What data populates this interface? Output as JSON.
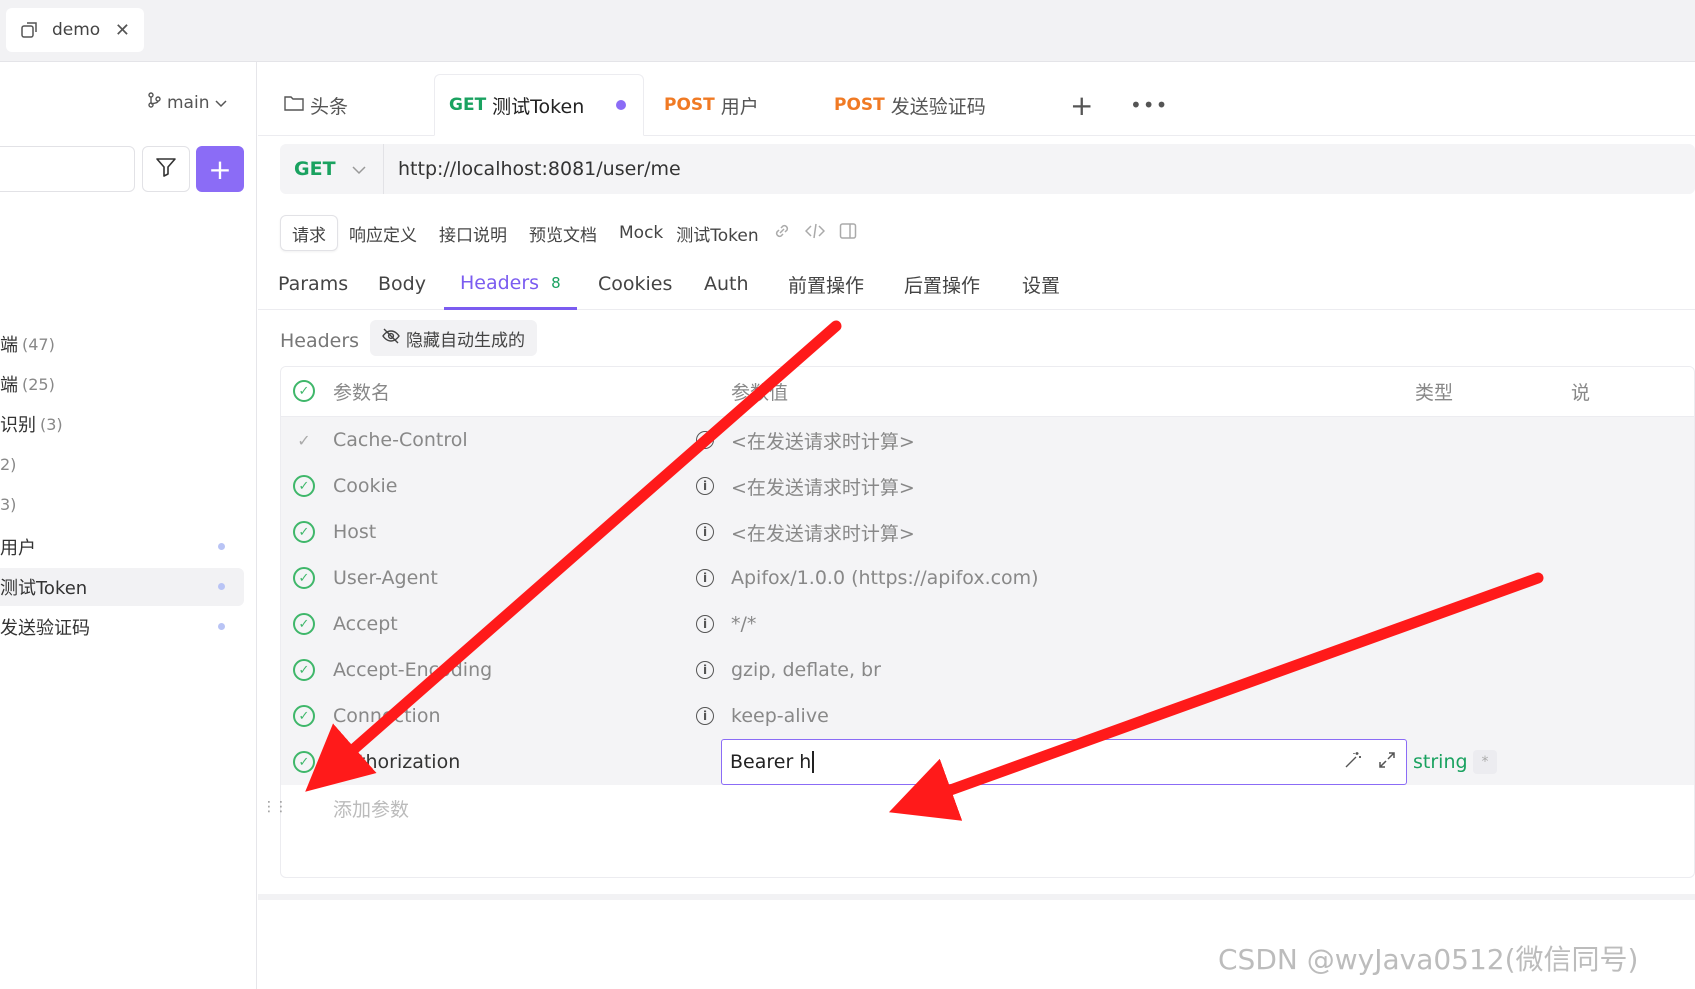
{
  "window_tab": {
    "title": "demo",
    "close": "✕"
  },
  "sidebar": {
    "branch": "main",
    "items": [
      {
        "label": "端",
        "count": "(47)"
      },
      {
        "label": "端",
        "count": "(25)"
      },
      {
        "label": "识别",
        "count": "(3)"
      },
      {
        "label": "2)",
        "count": ""
      },
      {
        "label": "3)",
        "count": ""
      },
      {
        "label": "用户",
        "count": ""
      },
      {
        "label": "测试Token",
        "count": ""
      },
      {
        "label": "发送验证码",
        "count": ""
      }
    ]
  },
  "request_tabs": [
    {
      "method": "",
      "label": "头条"
    },
    {
      "method": "GET",
      "label": "测试Token"
    },
    {
      "method": "POST",
      "label": "用户"
    },
    {
      "method": "POST",
      "label": "发送验证码"
    }
  ],
  "url_bar": {
    "method": "GET",
    "url": "http://localhost:8081/user/me"
  },
  "doc_tabs": [
    "请求",
    "响应定义",
    "接口说明",
    "预览文档",
    "Mock",
    "测试Token"
  ],
  "param_tabs": [
    {
      "label": "Params",
      "badge": ""
    },
    {
      "label": "Body",
      "badge": ""
    },
    {
      "label": "Headers",
      "badge": "8"
    },
    {
      "label": "Cookies",
      "badge": ""
    },
    {
      "label": "Auth",
      "badge": ""
    },
    {
      "label": "前置操作",
      "badge": ""
    },
    {
      "label": "后置操作",
      "badge": ""
    },
    {
      "label": "设置",
      "badge": ""
    }
  ],
  "headers_section": {
    "label": "Headers",
    "hide_auto_label": "隐藏自动生成的"
  },
  "table": {
    "columns": {
      "name": "参数名",
      "value": "参数值",
      "type": "类型",
      "desc": "说"
    },
    "auto_rows": [
      {
        "name": "Cache-Control",
        "value": "<在发送请求时计算>"
      },
      {
        "name": "Cookie",
        "value": "<在发送请求时计算>"
      },
      {
        "name": "Host",
        "value": "<在发送请求时计算>"
      },
      {
        "name": "User-Agent",
        "value": "Apifox/1.0.0 (https://apifox.com)"
      },
      {
        "name": "Accept",
        "value": "*/*"
      },
      {
        "name": "Accept-Encoding",
        "value": "gzip, deflate, br"
      },
      {
        "name": "Connection",
        "value": "keep-alive"
      }
    ],
    "auth_row": {
      "name": "Authorization",
      "value": "Bearer h",
      "type": "string",
      "required": "*"
    },
    "add_placeholder": "添加参数"
  },
  "watermark": "CSDN @wyJava0512(微信同号)",
  "colors": {
    "accent": "#8b6cf6",
    "get": "#1aa260",
    "post": "#f07a24",
    "annotation_arrow": "#ff1a1a"
  }
}
